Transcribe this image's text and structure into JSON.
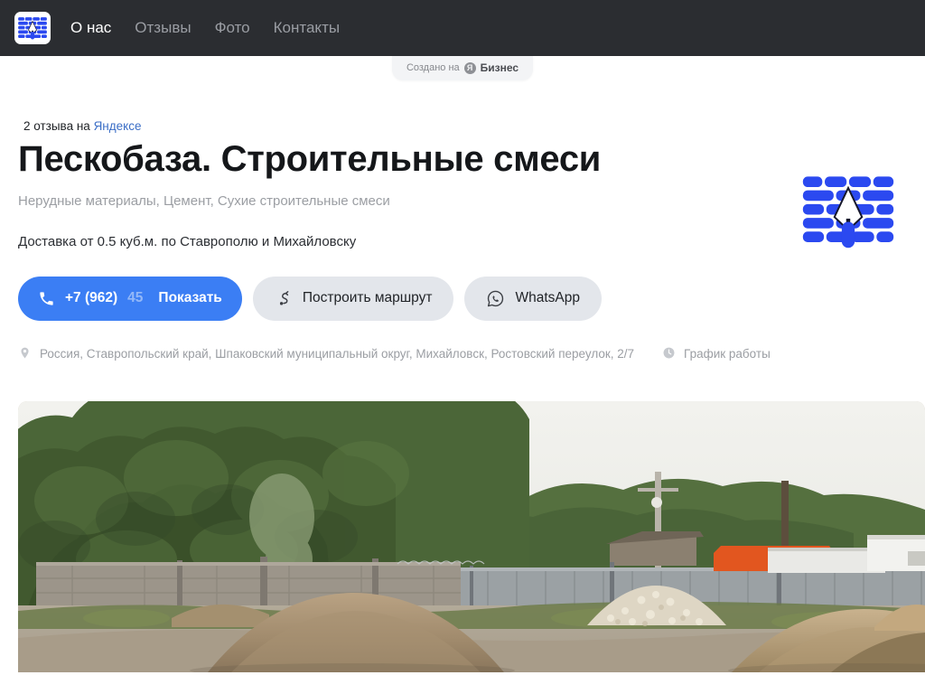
{
  "nav": {
    "logo_icon": "brick-wall-trowel-logo",
    "items": [
      {
        "label": "О нас",
        "active": true
      },
      {
        "label": "Отзывы",
        "active": false
      },
      {
        "label": "Фото",
        "active": false
      },
      {
        "label": "Контакты",
        "active": false
      }
    ]
  },
  "created_badge": {
    "prefix": "Создано на",
    "mark": "Я",
    "brand": "Бизнес"
  },
  "header": {
    "reviews_count_text": "2 отзыва на",
    "reviews_link": "Яндексе",
    "title": "Пескобаза. Строительные смеси",
    "categories": "Нерудные материалы, Цемент, Сухие строительные смеси",
    "tagline": "Доставка от 0.5 куб.м. по Ставрополю и Михайловску",
    "logo_icon": "brick-wall-trowel-logo"
  },
  "actions": {
    "phone": {
      "icon": "phone-icon",
      "number_visible": "+7 (962)",
      "number_masked": "45",
      "show_label": "Показать"
    },
    "route": {
      "icon": "route-icon",
      "label": "Построить маршрут"
    },
    "whatsapp": {
      "icon": "whatsapp-icon",
      "label": "WhatsApp"
    }
  },
  "info": {
    "address_icon": "map-pin-icon",
    "address": "Россия, Ставропольский край, Шпаковский муниципальный округ, Михайловск, Ростовский переулок, 2/7",
    "schedule_icon": "clock-icon",
    "schedule_label": "График работы"
  },
  "photo": {
    "alt": "Площадка с кучами песка и щебня, бетонный и металлический забор, деревья"
  },
  "colors": {
    "nav_bg": "#2b2d31",
    "accent": "#3b7ef4",
    "link": "#3b6ec6",
    "secondary_btn": "#e3e6eb",
    "muted_text": "#9b9ea3",
    "title_text": "#15171a",
    "logo_blue": "#2b49f0"
  }
}
